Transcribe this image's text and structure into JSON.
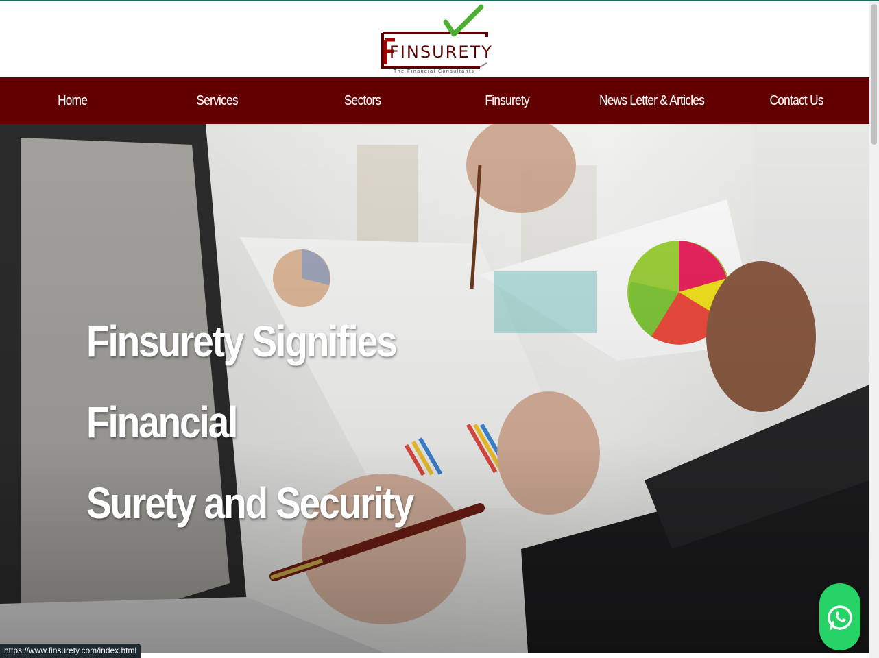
{
  "logo": {
    "name": "FINSURETY",
    "tagline": "The Financial Consultants",
    "colors": {
      "maroon": "#5a0000",
      "check": "#4caf32"
    }
  },
  "nav": {
    "items": [
      {
        "label": "Home"
      },
      {
        "label": "Services"
      },
      {
        "label": "Sectors"
      },
      {
        "label": "Finsurety"
      },
      {
        "label": "News Letter & Articles"
      },
      {
        "label": "Contact Us"
      }
    ],
    "background": "#620000"
  },
  "hero": {
    "title_line1": "Finsurety Signifies Financial",
    "title_line2": "Surety and Security"
  },
  "whatsapp": {
    "icon": "whatsapp-icon",
    "color": "#25d366"
  },
  "status_bar": {
    "url": "https://www.finsurety.com/index.html"
  }
}
